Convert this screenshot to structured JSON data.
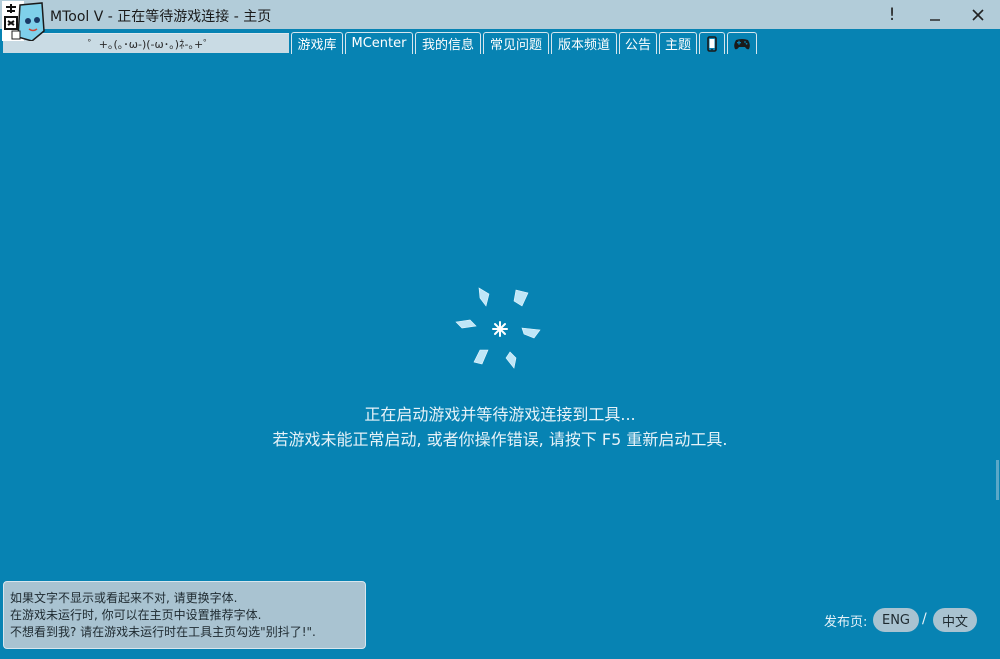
{
  "window": {
    "title": "MTool V - 正在等待游戏连接 - 主页",
    "controls": {
      "alert": "!",
      "minimize": "_",
      "close": "✕"
    }
  },
  "header": {
    "kaomoji": "゜+｡(｡･ω-)(-ω･｡)ﾈ-｡+゜"
  },
  "tabs": [
    {
      "label": "游戏库"
    },
    {
      "label": "MCenter"
    },
    {
      "label": "我的信息"
    },
    {
      "label": "常见问题"
    },
    {
      "label": "版本频道"
    },
    {
      "label": "公告"
    },
    {
      "label": "主题"
    }
  ],
  "icon_tabs": [
    {
      "icon": "phone-icon"
    },
    {
      "icon": "gamepad-icon"
    }
  ],
  "main": {
    "line1": "正在启动游戏并等待游戏连接到工具...",
    "line2": "若游戏未能正常启动, 或者你操作错误, 请按下 F5 重新启动工具."
  },
  "notice": {
    "lines": [
      "如果文字不显示或看起来不对, 请更换字体.",
      "在游戏未运行时, 你可以在主页中设置推荐字体.",
      "不想看到我? 请在游戏未运行时在工具主页勾选\"别抖了!\"."
    ]
  },
  "language": {
    "label": "发布页:",
    "options": [
      "ENG",
      "中文"
    ],
    "separator": "/"
  },
  "colors": {
    "background": "#0783b3",
    "titlebar": "#b2ccd9",
    "panel": "#a9c3d1",
    "spinner": "#bfe6f7"
  }
}
